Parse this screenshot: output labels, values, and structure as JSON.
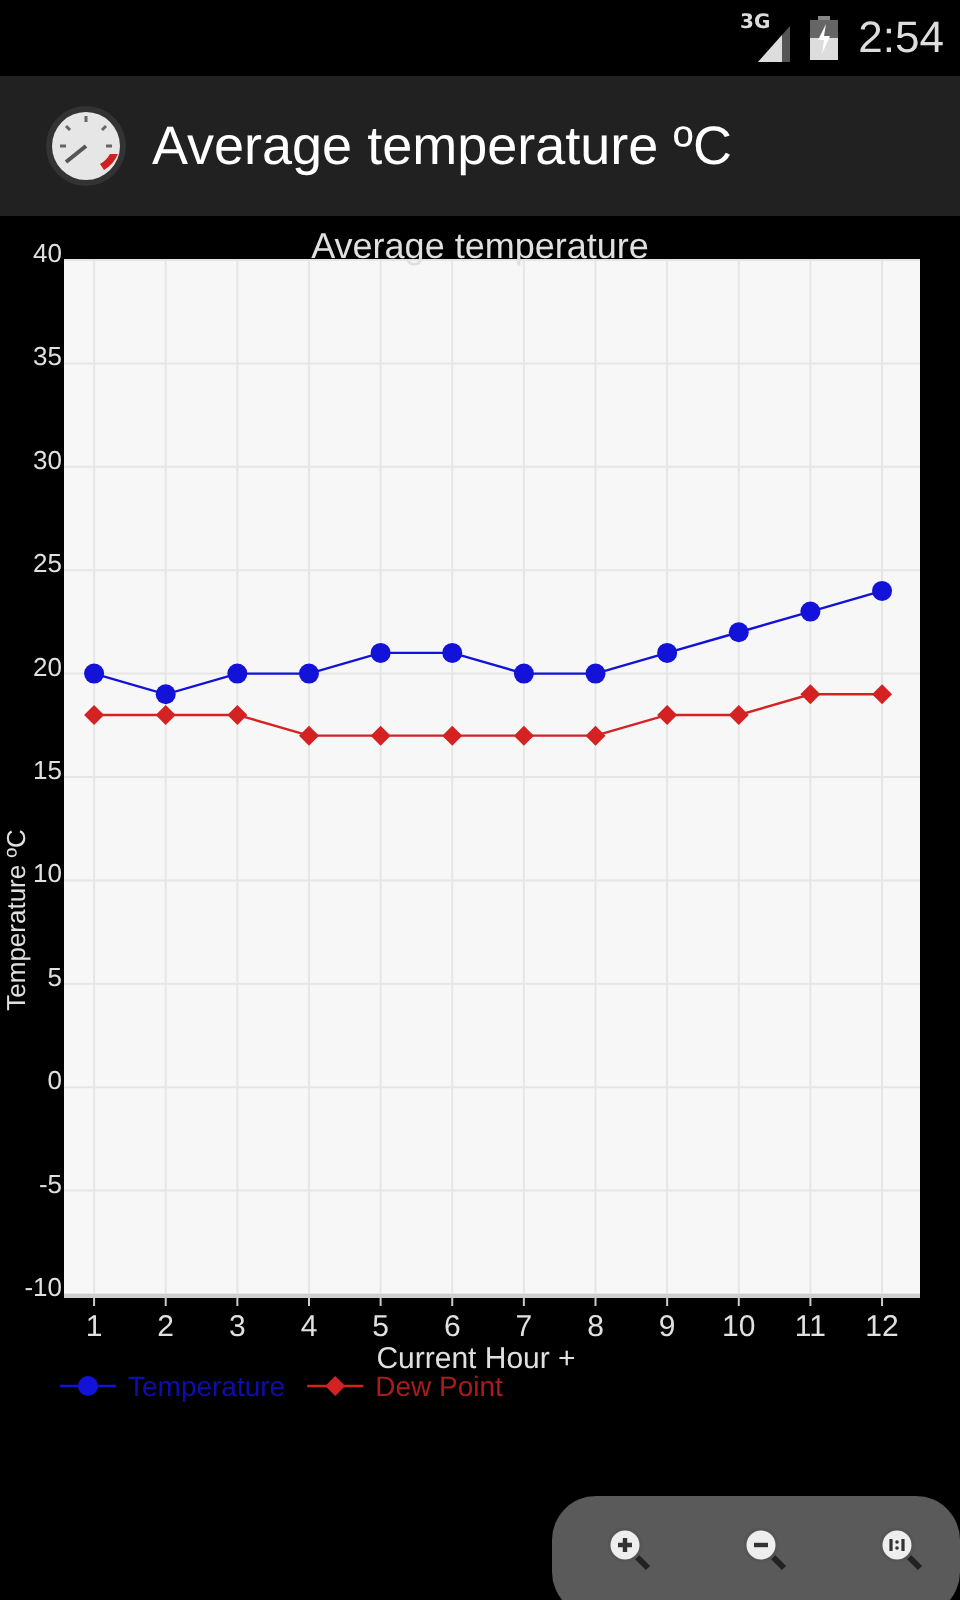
{
  "status_bar": {
    "network": "3G",
    "time": "2:54"
  },
  "action_bar": {
    "title": "Average temperature ºC"
  },
  "chart_data": {
    "type": "line",
    "title": "Average temperature",
    "xlabel": "Current Hour +",
    "ylabel": "Temperature ºC",
    "x": [
      1,
      2,
      3,
      4,
      5,
      6,
      7,
      8,
      9,
      10,
      11,
      12
    ],
    "series": [
      {
        "name": "Temperature",
        "color": "#1212d8",
        "marker": "circle",
        "values": [
          20,
          19,
          20,
          20,
          21,
          21,
          20,
          20,
          21,
          22,
          23,
          24
        ]
      },
      {
        "name": "Dew Point",
        "color": "#d42222",
        "marker": "diamond",
        "values": [
          18,
          18,
          18,
          17,
          17,
          17,
          17,
          17,
          18,
          18,
          19,
          19
        ]
      }
    ],
    "grid": true,
    "legend": true,
    "xlim": [
      0.58,
      12.53
    ],
    "ylim": [
      -10,
      40
    ],
    "xticks": [
      1,
      2,
      3,
      4,
      5,
      6,
      7,
      8,
      9,
      10,
      11,
      12
    ],
    "yticks": [
      -10,
      -5,
      0,
      5,
      10,
      15,
      20,
      25,
      30,
      35,
      40
    ]
  },
  "zoom_controls": [
    {
      "kind": "zoom_in"
    },
    {
      "kind": "zoom_out"
    },
    {
      "kind": "reset"
    }
  ]
}
